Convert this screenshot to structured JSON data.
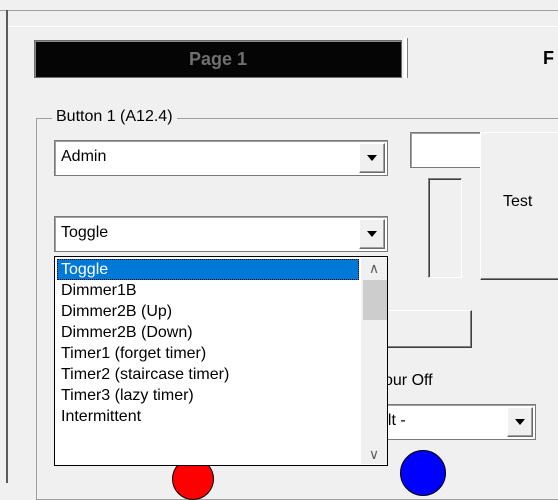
{
  "tabs": [
    {
      "label": "Page 1",
      "active": true
    },
    {
      "label": "F",
      "active": false
    }
  ],
  "group": {
    "title": "Button 1 (A12.4)"
  },
  "user_combo": {
    "value": "Admin"
  },
  "mode_combo": {
    "value": "Toggle"
  },
  "test_button": {
    "label": "Test"
  },
  "mode_list": {
    "items": [
      "Toggle",
      "Dimmer1B",
      "Dimmer2B (Up)",
      "Dimmer2B (Down)",
      "Timer1 (forget timer)",
      "Timer2 (staircase timer)",
      "Timer3 (lazy timer)",
      "Intermittent"
    ],
    "selected_index": 0
  },
  "colour_off_label": "our Off",
  "colour_combo": {
    "value": "ult -"
  },
  "colors": {
    "selection": "#0078d7",
    "active_tab_bg": "#050505",
    "indicator_on": "#ff0000",
    "indicator_off": "#0000ff"
  },
  "icons": [
    "dropdown-arrow-icon",
    "scroll-up-icon",
    "scroll-down-icon"
  ]
}
